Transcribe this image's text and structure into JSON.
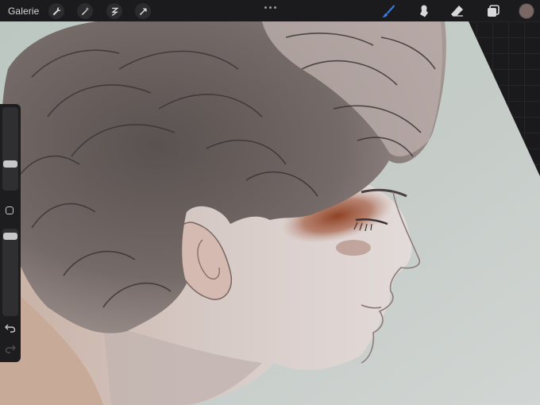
{
  "topbar": {
    "gallery_label": "Galerie",
    "left_tools": [
      "wrench-icon",
      "magic-wand-icon",
      "selection-icon",
      "transform-arrow-icon"
    ],
    "right_tools": [
      "brush-icon",
      "smudge-icon",
      "eraser-icon",
      "layers-icon"
    ],
    "active_tool": "brush-icon",
    "accent_color": "#3d7de0",
    "current_color": "#7a6763"
  },
  "sidebar": {
    "brush_size": 0.45,
    "opacity": 0.1
  },
  "canvas": {
    "background_color": "#c4ccc7",
    "skin_color": "#dcd0cb",
    "hair_color": "#6f6664",
    "blush_color": "#8a3a1c"
  }
}
